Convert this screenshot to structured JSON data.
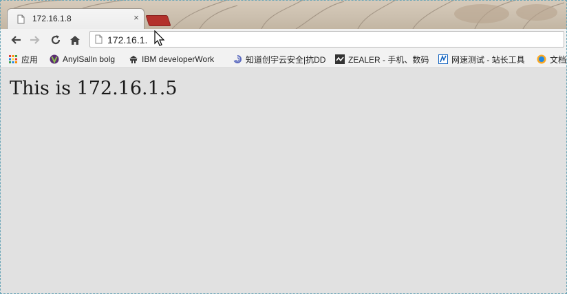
{
  "tab": {
    "title": "172.16.1.8",
    "close_glyph": "×"
  },
  "toolbar": {
    "back_icon": "back-arrow-icon",
    "forward_icon": "forward-arrow-icon",
    "reload_icon": "reload-icon",
    "home_icon": "home-icon",
    "address": "172.16.1."
  },
  "bookmarks": [
    {
      "label": "应用",
      "icon": "apps-grid-icon"
    },
    {
      "label": "AnylSalln bolg",
      "icon": "v-logo-icon"
    },
    {
      "label": "IBM developerWork",
      "icon": "ibm-icon"
    },
    {
      "label": "知道创宇云安全|抗DD",
      "icon": "cloud-swirl-icon"
    },
    {
      "label": "ZEALER - 手机、数码",
      "icon": "zealer-icon"
    },
    {
      "label": "网速测试 - 站长工具",
      "icon": "speedtest-icon"
    },
    {
      "label": "文档",
      "icon": "doc-icon"
    }
  ],
  "page": {
    "text": "This is 172.16.1.5"
  },
  "colors": {
    "page_background": "#e1e1e1",
    "new_tab_accent": "#b3312b"
  }
}
